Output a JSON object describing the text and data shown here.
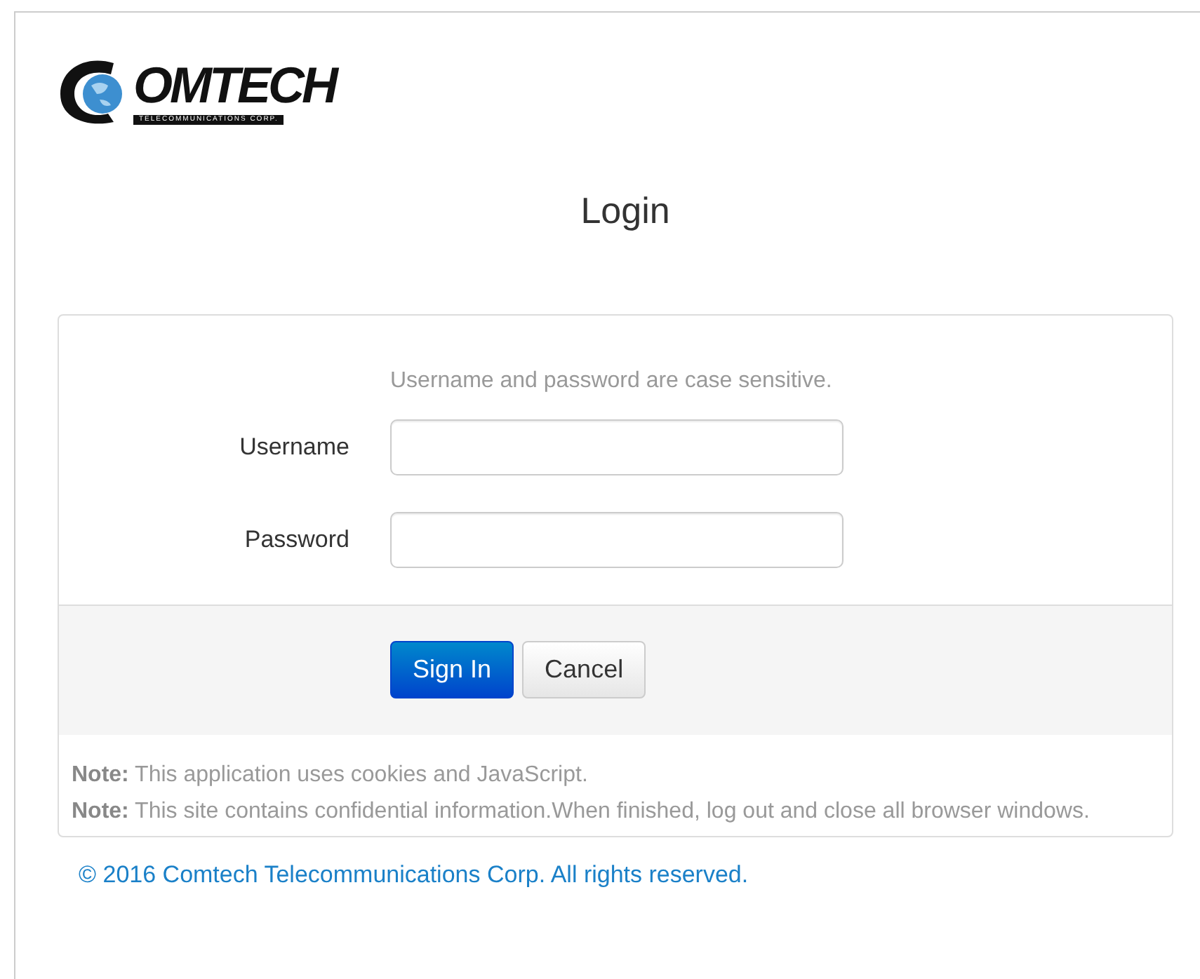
{
  "logo": {
    "text": "OMTECH",
    "tagline": "TELECOMMUNICATIONS CORP."
  },
  "title": "Login",
  "hint": "Username and password are case sensitive.",
  "fields": [
    {
      "label": "Username"
    },
    {
      "label": "Password"
    }
  ],
  "buttons": [
    {
      "label": "Sign In",
      "kind": "primary"
    },
    {
      "label": "Cancel",
      "kind": "default"
    }
  ],
  "notes": [
    "**Note:** This application uses cookies and JavaScript.",
    "**Note:** This site contains confidential information.When finished, log out and close all browser windows."
  ],
  "copyright": "© 2016 Comtech Telecommunications Corp. All rights reserved."
}
